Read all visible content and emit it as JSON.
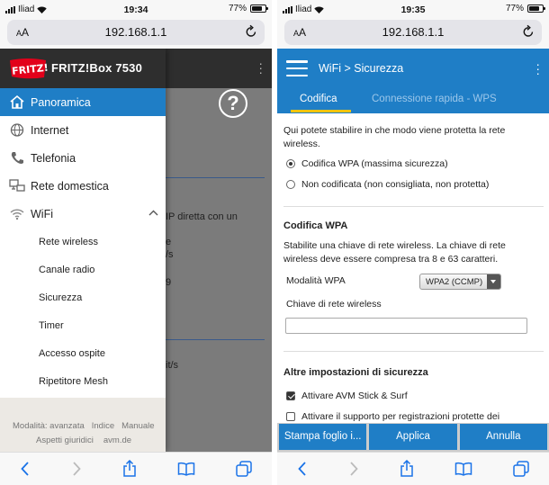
{
  "left": {
    "status": {
      "carrier": "Iliad",
      "time": "19:34",
      "battery": "77%",
      "battery_level": 0.77
    },
    "url": {
      "aa_label": "AA",
      "address": "192.168.1.1"
    },
    "app": {
      "brand": "FRITZ!Box 7530",
      "logo_text": "FRITZ!"
    },
    "nav": [
      {
        "label": "Panoramica",
        "icon": "home-icon",
        "active": true
      },
      {
        "label": "Internet",
        "icon": "globe-icon"
      },
      {
        "label": "Telefonia",
        "icon": "phone-icon"
      },
      {
        "label": "Rete domestica",
        "icon": "network-icon"
      },
      {
        "label": "WiFi",
        "icon": "wifi-icon",
        "expanded": true
      }
    ],
    "wifi_sub": [
      "Rete wireless",
      "Canale radio",
      "Sicurezza",
      "Timer",
      "Accesso ospite",
      "Ripetitore Mesh"
    ],
    "footer": {
      "row1": [
        "Modalità: avanzata",
        "Indice",
        "Manuale"
      ],
      "row2": [
        "Aspetti giuridici",
        "avm.de"
      ]
    },
    "background_fragments": [
      "IP diretta con un",
      "e",
      "/s",
      "9",
      "it/s"
    ]
  },
  "right": {
    "status": {
      "carrier": "Iliad",
      "time": "19:35",
      "battery": "77%",
      "battery_level": 0.77
    },
    "url": {
      "aa_label": "AA",
      "address": "192.168.1.1"
    },
    "header": {
      "section": "WiFi",
      "separator": ">",
      "page": "Sicurezza"
    },
    "tabs": [
      {
        "label": "Codifica",
        "active": true
      },
      {
        "label": "Connessione rapida - WPS",
        "active": false
      }
    ],
    "intro": "Qui potete stabilire in che modo viene protetta la rete wireless.",
    "radio_options": [
      {
        "label": "Codifica WPA (massima sicurezza)",
        "selected": true
      },
      {
        "label": "Non codificata (non consigliata, non protetta)",
        "selected": false
      }
    ],
    "wpa_section": {
      "title": "Codifica WPA",
      "description": "Stabilite una chiave di rete wireless. La chiave di rete wireless deve essere compresa tra 8 e 63 caratteri.",
      "mode_label": "Modalità WPA",
      "mode_value": "WPA2 (CCMP)",
      "key_label": "Chiave di rete wireless",
      "key_value": ""
    },
    "other_section": {
      "title": "Altre impostazioni di sicurezza",
      "checks": [
        {
          "label": "Attivare AVM Stick & Surf",
          "checked": true
        },
        {
          "label": "Attivare il supporto per registrazioni protette dei",
          "checked": false
        }
      ]
    },
    "buttons": [
      "Stampa foglio i...",
      "Applica",
      "Annulla"
    ]
  },
  "colors": {
    "accent": "#1f7ec6",
    "tab_underline": "#f1c40f",
    "header_dark": "#2e2e2e",
    "logo_red": "#e2001a"
  }
}
